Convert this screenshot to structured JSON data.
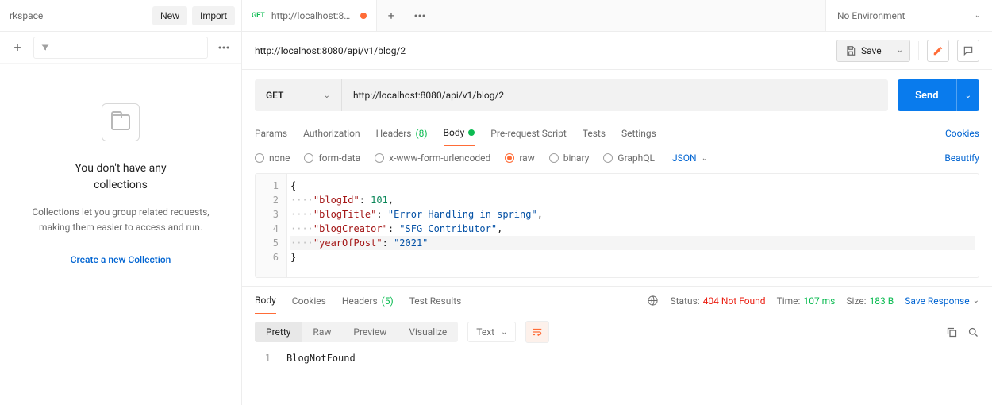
{
  "sidebar": {
    "workspace_label": "rkspace",
    "new_btn": "New",
    "import_btn": "Import",
    "empty_title1": "You don't have any",
    "empty_title2": "collections",
    "empty_sub": "Collections let you group related requests, making them easier to access and run.",
    "create_link": "Create a new Collection"
  },
  "tabs": {
    "tab1_method": "GET",
    "tab1_title": "http://localhost:80...",
    "env_label": "No Environment"
  },
  "crumb": {
    "path": "http://localhost:8080/api/v1/blog/2",
    "save": "Save"
  },
  "request": {
    "method": "GET",
    "url": "http://localhost:8080/api/v1/blog/2",
    "send": "Send"
  },
  "req_tabs": {
    "params": "Params",
    "auth": "Authorization",
    "headers": "Headers",
    "headers_count": "(8)",
    "body": "Body",
    "prereq": "Pre-request Script",
    "tests": "Tests",
    "settings": "Settings",
    "cookies": "Cookies"
  },
  "body_types": {
    "none": "none",
    "formdata": "form-data",
    "xwww": "x-www-form-urlencoded",
    "raw": "raw",
    "binary": "binary",
    "graphql": "GraphQL",
    "json": "JSON",
    "beautify": "Beautify"
  },
  "editor": {
    "lines": [
      "1",
      "2",
      "3",
      "4",
      "5",
      "6"
    ],
    "l1_brace": "{",
    "l2_key": "\"blogId\"",
    "l2_colon": ": ",
    "l2_val": "101",
    "l2_comma": ",",
    "l3_key": "\"blogTitle\"",
    "l3_colon": ": ",
    "l3_val": "\"Error Handling in spring\"",
    "l3_comma": ",",
    "l4_key": "\"blogCreator\"",
    "l4_colon": ": ",
    "l4_val": "\"SFG Contributor\"",
    "l4_comma": ",",
    "l5_key": "\"yearOfPost\"",
    "l5_colon": ": ",
    "l5_val": "\"2021\"",
    "l6_brace": "}",
    "indent": "····"
  },
  "resp_tabs": {
    "body": "Body",
    "cookies": "Cookies",
    "headers": "Headers",
    "headers_count": "(5)",
    "results": "Test Results"
  },
  "resp_meta": {
    "status_label": "Status:",
    "status_val": "404 Not Found",
    "time_label": "Time:",
    "time_val": "107 ms",
    "size_label": "Size:",
    "size_val": "183 B",
    "save_resp": "Save Response"
  },
  "resp_view": {
    "pretty": "Pretty",
    "raw": "Raw",
    "preview": "Preview",
    "visualize": "Visualize",
    "text": "Text"
  },
  "resp_body": {
    "line_no": "1",
    "content": "BlogNotFound"
  }
}
